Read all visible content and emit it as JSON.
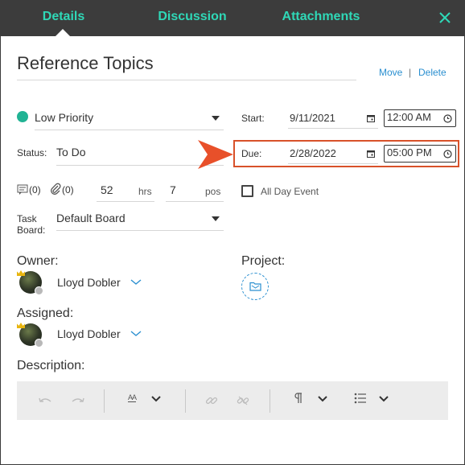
{
  "tabs": [
    {
      "label": "Details",
      "active": true
    },
    {
      "label": "Discussion",
      "active": false
    },
    {
      "label": "Attachments",
      "active": false
    }
  ],
  "colors": {
    "accent": "#2fd8b7",
    "header_bg": "#3c3c3c",
    "link": "#2a8fd0",
    "highlight": "#d8512a",
    "priority_dot": "#21b394"
  },
  "title": "Reference Topics",
  "actions": {
    "move": "Move",
    "separator": "|",
    "delete": "Delete"
  },
  "priority": {
    "value": "Low Priority"
  },
  "status": {
    "label": "Status:",
    "value": "To Do"
  },
  "start": {
    "label": "Start:",
    "date": "9/11/2021",
    "time": "12:00 AM"
  },
  "due": {
    "label": "Due:",
    "date": "2/28/2022",
    "time": "05:00 PM"
  },
  "counts": {
    "notes": "(0)",
    "attachments": "(0)",
    "hours": "52",
    "hours_unit": "hrs",
    "points": "7",
    "points_unit": "pos"
  },
  "all_day": {
    "label": "All Day Event",
    "checked": false
  },
  "task_board": {
    "label_line1": "Task",
    "label_line2": "Board:",
    "value": "Default Board"
  },
  "owner": {
    "label": "Owner:",
    "name": "Lloyd Dobler"
  },
  "assigned": {
    "label": "Assigned:",
    "name": "Lloyd Dobler"
  },
  "project": {
    "label": "Project:"
  },
  "description": {
    "label": "Description:"
  },
  "editor_toolbar": {
    "font_size_glyph": "AA"
  }
}
